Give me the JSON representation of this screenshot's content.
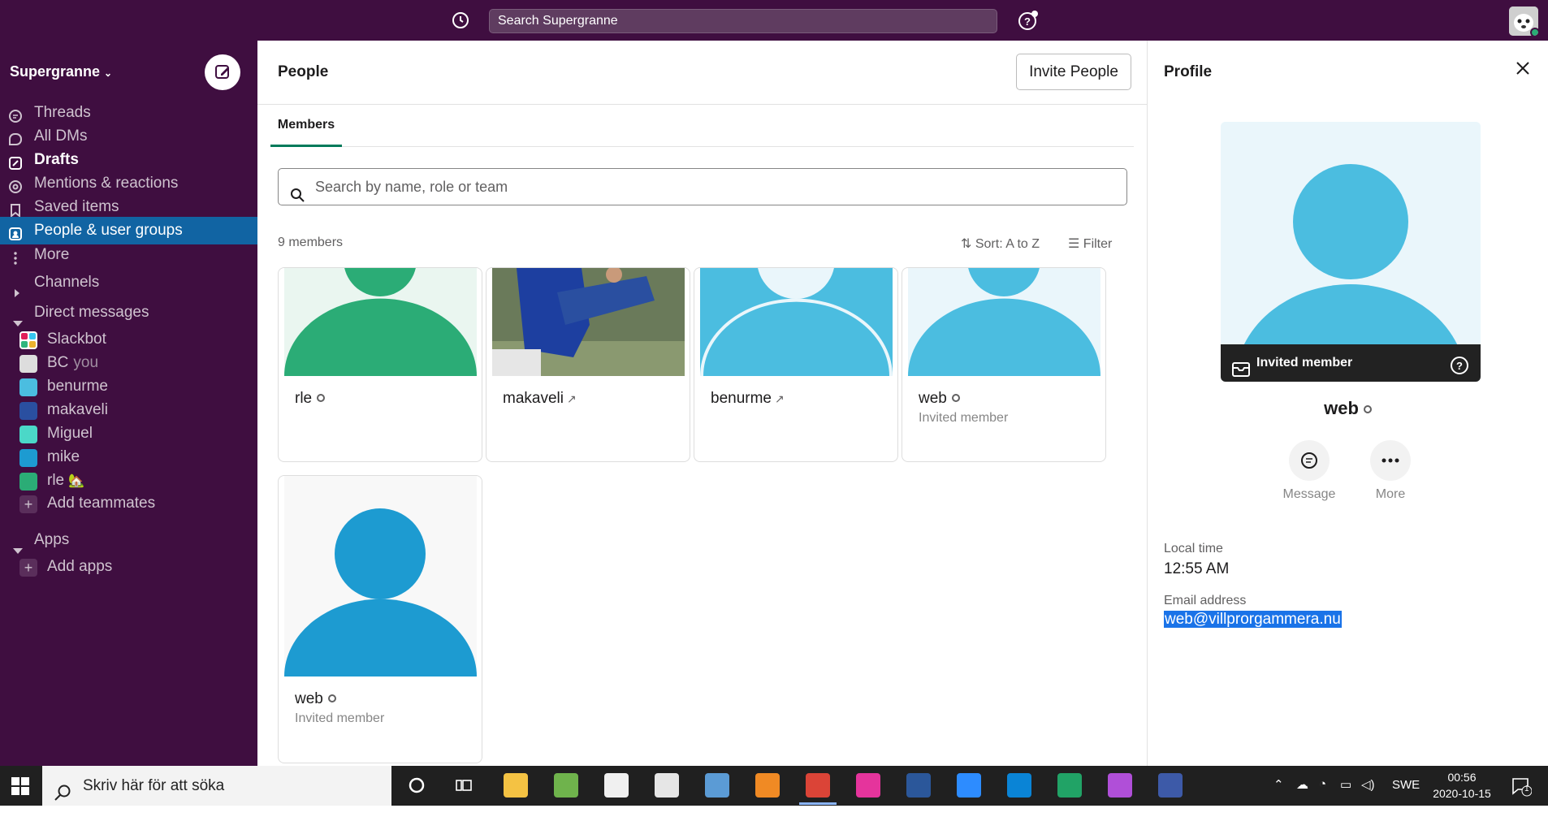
{
  "topbar": {
    "search_placeholder": "Search Supergranne"
  },
  "sidebar": {
    "workspace": "Supergranne",
    "nav": [
      {
        "label": "Threads",
        "icon": "threads-icon"
      },
      {
        "label": "All DMs",
        "icon": "dms-icon"
      },
      {
        "label": "Drafts",
        "icon": "drafts-icon"
      },
      {
        "label": "Mentions & reactions",
        "icon": "at-icon"
      },
      {
        "label": "Saved items",
        "icon": "bookmark-icon"
      },
      {
        "label": "People & user groups",
        "icon": "people-icon"
      },
      {
        "label": "More",
        "icon": "more-icon"
      }
    ],
    "channels_label": "Channels",
    "dms_label": "Direct messages",
    "dms": [
      {
        "name": "Slackbot"
      },
      {
        "name": "BC",
        "you": "you"
      },
      {
        "name": "benurme"
      },
      {
        "name": "makaveli"
      },
      {
        "name": "Miguel"
      },
      {
        "name": "mike"
      },
      {
        "name": "rle",
        "emoji": "🏡"
      }
    ],
    "add_teammates": "Add teammates",
    "apps_label": "Apps",
    "add_apps": "Add apps"
  },
  "main": {
    "title": "People",
    "invite_label": "Invite People",
    "tab_members": "Members",
    "search_placeholder": "Search by name, role or team",
    "member_count": "9 members",
    "sort_label": "Sort: A to Z",
    "filter_label": "Filter",
    "cards": [
      {
        "name": "rle",
        "sub": "",
        "color": "#2bac76"
      },
      {
        "name": "makaveli",
        "sub": "",
        "color": "#2a4fa0"
      },
      {
        "name": "benurme",
        "sub": "",
        "color": "#4bbde0"
      },
      {
        "name": "web",
        "sub": "Invited member",
        "color": "#4bbde0"
      },
      {
        "name": "web",
        "sub": "Invited member",
        "color": "#1d9bd1"
      }
    ]
  },
  "profile": {
    "title": "Profile",
    "badge": "Invited member",
    "name": "web",
    "message_label": "Message",
    "more_label": "More",
    "local_time_label": "Local time",
    "local_time": "12:55 AM",
    "email_label": "Email address",
    "email": "web@villprorgammera.nu"
  },
  "taskbar": {
    "search_placeholder": "Skriv här för att söka",
    "lang": "SWE",
    "time": "00:56",
    "date": "2020-10-15",
    "notif_count": "1"
  }
}
